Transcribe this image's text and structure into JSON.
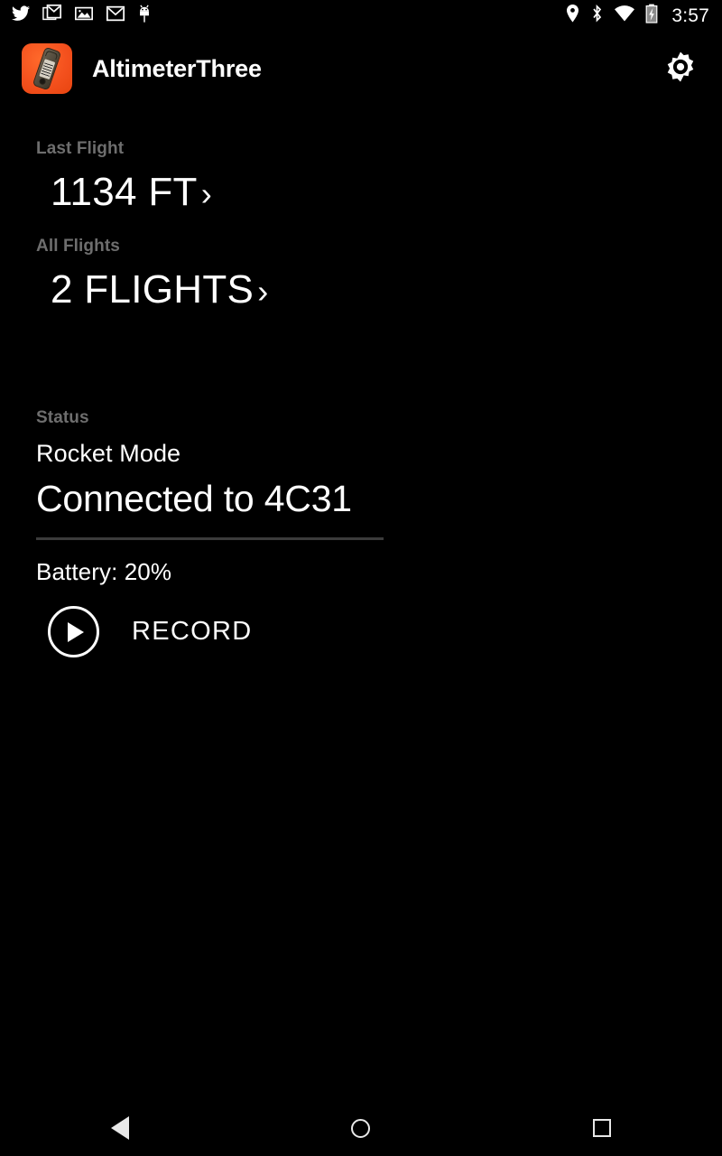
{
  "status_bar": {
    "left_icons": [
      {
        "name": "twitter-icon",
        "label": "Twitter"
      },
      {
        "name": "gmail-multi-icon",
        "label": "Gmail (multiple)"
      },
      {
        "name": "photo-icon",
        "label": "Photos"
      },
      {
        "name": "gmail-icon",
        "label": "Gmail"
      },
      {
        "name": "android-icon",
        "label": "Android"
      }
    ],
    "right_icons": [
      {
        "name": "location-icon",
        "label": "Location"
      },
      {
        "name": "bluetooth-icon",
        "label": "Bluetooth"
      },
      {
        "name": "wifi-icon",
        "label": "Wi-Fi"
      },
      {
        "name": "battery-charging-icon",
        "label": "Battery charging"
      }
    ],
    "clock": "3:57"
  },
  "action_bar": {
    "app_title": "AltimeterThree",
    "app_icon_name": "altimeter-app-icon",
    "app_icon_color": "#f4511e",
    "settings_icon_name": "gear-icon"
  },
  "main": {
    "last_flight": {
      "label": "Last Flight",
      "value": "1134 FT",
      "chevron": "›"
    },
    "all_flights": {
      "label": "All Flights",
      "value": "2 FLIGHTS",
      "chevron": "›"
    },
    "status": {
      "label": "Status",
      "mode": "Rocket Mode",
      "connection": "Connected to 4C31",
      "battery": "Battery: 20%"
    },
    "record": {
      "label": "RECORD",
      "icon_name": "play-icon"
    }
  },
  "nav_bar": {
    "back": "Back",
    "home": "Home",
    "recents": "Recents"
  },
  "colors": {
    "background": "#000000",
    "text_primary": "#ffffff",
    "text_label": "#6e6e6e",
    "divider": "#3b3b3b",
    "accent": "#f4511e"
  }
}
